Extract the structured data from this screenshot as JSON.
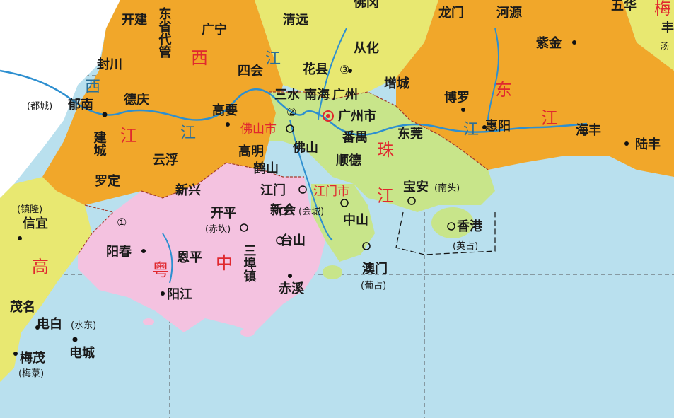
{
  "colors": {
    "sea": "#b9e0ee",
    "orange_region": "#f1a72a",
    "yellow_region": "#e8e871",
    "pink_region": "#f4c2e0",
    "green_region": "#c8e58a",
    "white_region": "#ffffff",
    "river": "#2d8fd0",
    "boundary": "#a33a2a",
    "label_red": "#e0282e"
  },
  "icons": [
    "capital-icon",
    "city-icon",
    "county-icon"
  ],
  "cities": {
    "guangzhou": "广州",
    "guangzhou_shi": "广州市",
    "foshan": "佛山",
    "foshan_shi": "佛山市",
    "jiangmen": "江门",
    "jiangmen_shi": "江门市",
    "zhongshan": "中山",
    "shunde": "顺德",
    "panyu": "番禺",
    "dongguan": "东莞",
    "baoan": "宝安",
    "baoan_note": "(南头)",
    "hongkong": "香港",
    "hongkong_note": "(英占)",
    "macau": "澳门",
    "macau_note": "(葡占)",
    "huadu": "花县",
    "conghua": "从化",
    "zengcheng": "增城",
    "boluo": "博罗",
    "huiyang": "惠阳",
    "haifeng": "海丰",
    "lufeng": "陆丰",
    "zijin": "紫金",
    "heyuan": "河源",
    "longmen": "龙门",
    "fogang": "佛冈",
    "qingyuan": "清远",
    "wuhua": "五华",
    "sihui": "四会",
    "gaoyao": "高要",
    "gaoming": "高明",
    "heshan": "鹤山",
    "xinhui": "新会",
    "xinhui_note": "(会城)",
    "kaiping": "开平",
    "kaiping_note": "(赤坎)",
    "taishan": "台山",
    "enping": "恩平",
    "sanbu": "三埠镇",
    "chixi": "赤溪",
    "yangjiang": "阳江",
    "yangchun": "阳春",
    "xinxing": "新兴",
    "yunfu": "云浮",
    "luoding": "罗定",
    "deqing": "德庆",
    "yunan": "郁南",
    "yunan_note": "(都城)",
    "fengchuan": "封川",
    "kaijian": "开建",
    "guangning": "广宁",
    "xinyi": "信宜",
    "xinyi_note": "(镇隆)",
    "maoming": "茂名",
    "dianbai": "电白",
    "dianbai_note": "(水东)",
    "diancheng": "电城",
    "maomao": "梅茂",
    "maomao_note": "(梅菉)",
    "jiancheng": "建城",
    "nanhai": "南海",
    "sanshui": "三水",
    "huaiji_partial": "东省代管"
  },
  "labels": {
    "xijiang_1": "西",
    "xijiang_2": "江",
    "xijiang_left": "西",
    "xijiang_left2": "江",
    "dongjiang_1": "东",
    "dongjiang_2": "江",
    "zhujiang_1": "珠",
    "zhujiang_2": "江",
    "yuezhong_1": "粤",
    "yuezhong_2": "中",
    "gaozhou_1": "高",
    "river_jiang_1": "江",
    "river_jiang_2": "江",
    "river_jiang_3": "江",
    "mei": "梅",
    "feng": "丰",
    "tang": "汤"
  },
  "markers": {
    "m1": "①",
    "m2": "②",
    "m3": "③"
  }
}
